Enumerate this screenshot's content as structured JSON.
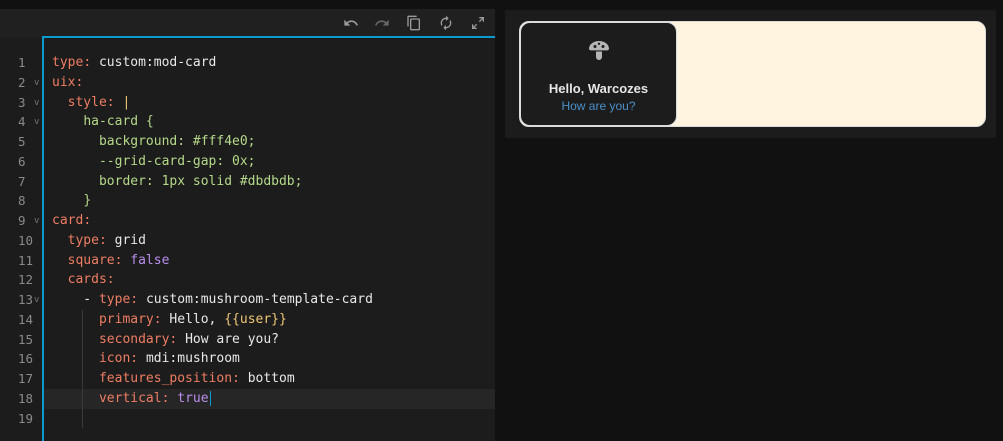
{
  "editor": {
    "toolbar": {
      "undo_icon": "undo-icon",
      "redo_icon": "redo-icon",
      "copy_icon": "copy-icon",
      "refresh_icon": "refresh-icon",
      "expand_icon": "expand-icon"
    },
    "line_numbers": [
      "1",
      "2",
      "3",
      "4",
      "5",
      "6",
      "7",
      "8",
      "9",
      "10",
      "11",
      "12",
      "13",
      "14",
      "15",
      "16",
      "17",
      "18",
      "19"
    ],
    "lines": [
      {
        "key": "type",
        "sep": ": ",
        "value": "custom:mod-card",
        "vclass": "s",
        "indent": ""
      },
      {
        "key": "uix",
        "sep": ":",
        "value": "",
        "vclass": "s",
        "indent": ""
      },
      {
        "key": "style",
        "sep": ": ",
        "value": "|",
        "vclass": "y",
        "indent": "  "
      },
      {
        "key": "",
        "sep": "",
        "value": "ha-card {",
        "vclass": "g",
        "indent": "    "
      },
      {
        "key": "",
        "sep": "",
        "value": "background: #fff4e0;",
        "vclass": "g",
        "indent": "      "
      },
      {
        "key": "",
        "sep": "",
        "value": "--grid-card-gap: 0x;",
        "vclass": "g",
        "indent": "      "
      },
      {
        "key": "",
        "sep": "",
        "value": "border: 1px solid #dbdbdb;",
        "vclass": "g",
        "indent": "      "
      },
      {
        "key": "",
        "sep": "",
        "value": "}",
        "vclass": "g",
        "indent": "    "
      },
      {
        "key": "card",
        "sep": ":",
        "value": "",
        "vclass": "s",
        "indent": ""
      },
      {
        "key": "type",
        "sep": ": ",
        "value": "grid",
        "vclass": "s",
        "indent": "  "
      },
      {
        "key": "square",
        "sep": ": ",
        "value": "false",
        "vclass": "b",
        "indent": "  "
      },
      {
        "key": "cards",
        "sep": ":",
        "value": "",
        "vclass": "s",
        "indent": "  "
      },
      {
        "key": "type",
        "sep": ": ",
        "value": "custom:mushroom-template-card",
        "vclass": "s",
        "indent": "    - "
      },
      {
        "key": "primary",
        "sep": ": ",
        "value": "Hello, ",
        "vclass": "s",
        "indent": "      ",
        "extra": "{{user}}"
      },
      {
        "key": "secondary",
        "sep": ": ",
        "value": "How are you?",
        "vclass": "s",
        "indent": "      "
      },
      {
        "key": "icon",
        "sep": ": ",
        "value": "mdi:mushroom",
        "vclass": "s",
        "indent": "      "
      },
      {
        "key": "features_position",
        "sep": ": ",
        "value": "bottom",
        "vclass": "s",
        "indent": "      "
      },
      {
        "key": "vertical",
        "sep": ": ",
        "value": "true",
        "vclass": "b",
        "indent": "      ",
        "cursor": true
      },
      {
        "key": "",
        "sep": "",
        "value": "",
        "vclass": "s",
        "indent": ""
      }
    ],
    "folds": [
      false,
      true,
      true,
      true,
      false,
      false,
      false,
      false,
      true,
      false,
      false,
      false,
      true,
      false,
      false,
      false,
      false,
      false,
      false
    ],
    "active_line": 18
  },
  "preview": {
    "card": {
      "icon": "mushroom-icon",
      "primary": "Hello, Warcozes",
      "secondary": "How are you?"
    },
    "colors": {
      "background": "#fff4e0",
      "border": "#dbdbdb",
      "secondary_text": "#4a8fc9"
    }
  }
}
